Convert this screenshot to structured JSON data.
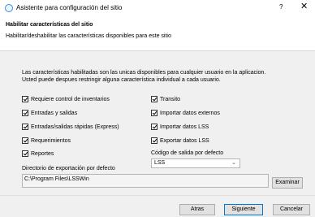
{
  "window": {
    "title": "Asistente para configuración del sitio",
    "help": "?",
    "close": "✕"
  },
  "header": {
    "title": "Habilitar características del sitio",
    "subtitle": "Habilitar/deshabilitar las características disponibles para este sitio"
  },
  "description": {
    "line1": "Las características habilitadas son las unicas disponibles para cualquier usuario en la aplicacion.",
    "line2": "Usted puede despues restringir alguna característica individual a cada usuario."
  },
  "features_left": [
    {
      "label": "Requiere control de inventarios",
      "checked": true
    },
    {
      "label": "Entradas y salidas",
      "checked": true
    },
    {
      "label": "Entradas/salidas rápidas (Express)",
      "checked": true
    },
    {
      "label": "Requerimientos",
      "checked": true
    },
    {
      "label": "Reportes",
      "checked": true
    }
  ],
  "features_right": [
    {
      "label": "Transito",
      "checked": true
    },
    {
      "label": "Importar datos externos",
      "checked": true
    },
    {
      "label": "Importar datos LSS",
      "checked": true
    },
    {
      "label": "Exportar datos LSS",
      "checked": true
    }
  ],
  "exit_code": {
    "label": "Código de salida por defecto",
    "value": "LSS"
  },
  "export_dir": {
    "label": "Directorio de exportación por defecto",
    "value": "C:\\Program Files\\LSSWin",
    "browse_label": "Examinar"
  },
  "footer": {
    "back_label": "Atras",
    "next_label": "Siguiente",
    "cancel_label": "Cancelar"
  }
}
